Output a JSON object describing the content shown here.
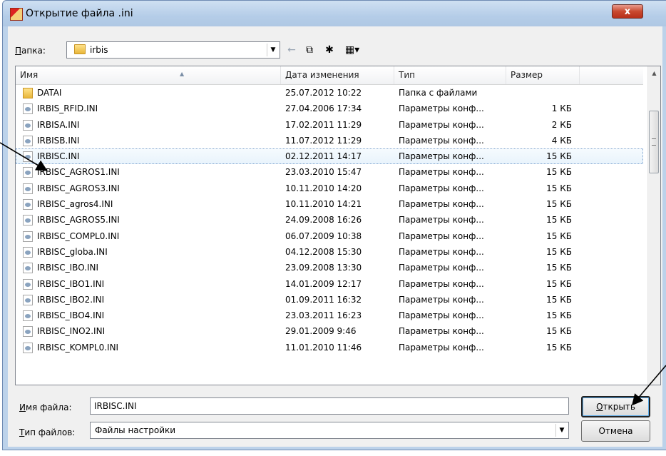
{
  "window": {
    "title": "Открытие файла .ini",
    "close_glyph": "x"
  },
  "lookin": {
    "label_underlined": "П",
    "label_rest": "апка:",
    "value": "irbis",
    "dropdown_glyph": "▼"
  },
  "toolbar": {
    "back_glyph": "←",
    "up_glyph": "⧉",
    "newfolder_glyph": "✱",
    "views_glyph": "▦▾"
  },
  "columns": {
    "name": "Имя",
    "date": "Дата изменения",
    "type": "Тип",
    "size": "Размер",
    "sort_glyph": "▲"
  },
  "files": [
    {
      "name": "DATAI",
      "date": "25.07.2012 10:22",
      "type": "Папка с файлами",
      "size": "",
      "icon": "folder-icon"
    },
    {
      "name": "IRBIS_RFID.INI",
      "date": "27.04.2006 17:34",
      "type": "Параметры конф...",
      "size": "1 КБ",
      "icon": "settings-file-icon"
    },
    {
      "name": "IRBISA.INI",
      "date": "17.02.2011 11:29",
      "type": "Параметры конф...",
      "size": "2 КБ",
      "icon": "settings-file-icon"
    },
    {
      "name": "IRBISB.INI",
      "date": "11.07.2012 11:29",
      "type": "Параметры конф...",
      "size": "4 КБ",
      "icon": "settings-file-icon"
    },
    {
      "name": "IRBISC.INI",
      "date": "02.12.2011 14:17",
      "type": "Параметры конф...",
      "size": "15 КБ",
      "icon": "settings-file-icon",
      "selected": true
    },
    {
      "name": "IRBISC_AGROS1.INI",
      "date": "23.03.2010 15:47",
      "type": "Параметры конф...",
      "size": "15 КБ",
      "icon": "settings-file-icon"
    },
    {
      "name": "IRBISC_AGROS3.INI",
      "date": "10.11.2010 14:20",
      "type": "Параметры конф...",
      "size": "15 КБ",
      "icon": "settings-file-icon"
    },
    {
      "name": "IRBISC_agros4.INI",
      "date": "10.11.2010 14:21",
      "type": "Параметры конф...",
      "size": "15 КБ",
      "icon": "settings-file-icon"
    },
    {
      "name": "IRBISC_AGROS5.INI",
      "date": "24.09.2008 16:26",
      "type": "Параметры конф...",
      "size": "15 КБ",
      "icon": "settings-file-icon"
    },
    {
      "name": "IRBISC_COMPL0.INI",
      "date": "06.07.2009 10:38",
      "type": "Параметры конф...",
      "size": "15 КБ",
      "icon": "settings-file-icon"
    },
    {
      "name": "IRBISC_globa.INI",
      "date": "04.12.2008 15:30",
      "type": "Параметры конф...",
      "size": "15 КБ",
      "icon": "settings-file-icon"
    },
    {
      "name": "IRBISC_IBO.INI",
      "date": "23.09.2008 13:30",
      "type": "Параметры конф...",
      "size": "15 КБ",
      "icon": "settings-file-icon"
    },
    {
      "name": "IRBISC_IBO1.INI",
      "date": "14.01.2009 12:17",
      "type": "Параметры конф...",
      "size": "15 КБ",
      "icon": "settings-file-icon"
    },
    {
      "name": "IRBISC_IBO2.INI",
      "date": "01.09.2011 16:32",
      "type": "Параметры конф...",
      "size": "15 КБ",
      "icon": "settings-file-icon"
    },
    {
      "name": "IRBISC_IBO4.INI",
      "date": "23.03.2011 16:23",
      "type": "Параметры конф...",
      "size": "15 КБ",
      "icon": "settings-file-icon"
    },
    {
      "name": "IRBISC_INO2.INI",
      "date": "29.01.2009 9:46",
      "type": "Параметры конф...",
      "size": "15 КБ",
      "icon": "settings-file-icon"
    },
    {
      "name": "IRBISC_KOMPL0.INI",
      "date": "11.01.2010 11:46",
      "type": "Параметры конф...",
      "size": "15 КБ",
      "icon": "settings-file-icon"
    }
  ],
  "scrollbar": {
    "up_glyph": "▲"
  },
  "filename": {
    "label_underlined": "И",
    "label_rest": "мя файла:",
    "value": "IRBISC.INI"
  },
  "filetype": {
    "label_underlined": "Т",
    "label_rest": "ип файлов:",
    "value": "Файлы настройки",
    "dropdown_glyph": "▼"
  },
  "buttons": {
    "open_underlined": "О",
    "open_rest": "ткрыть",
    "cancel": "Отмена"
  },
  "colors": {
    "selection_border": "#7da2ce",
    "titlebar": "#b5cde8",
    "close_button": "#c9492f"
  }
}
